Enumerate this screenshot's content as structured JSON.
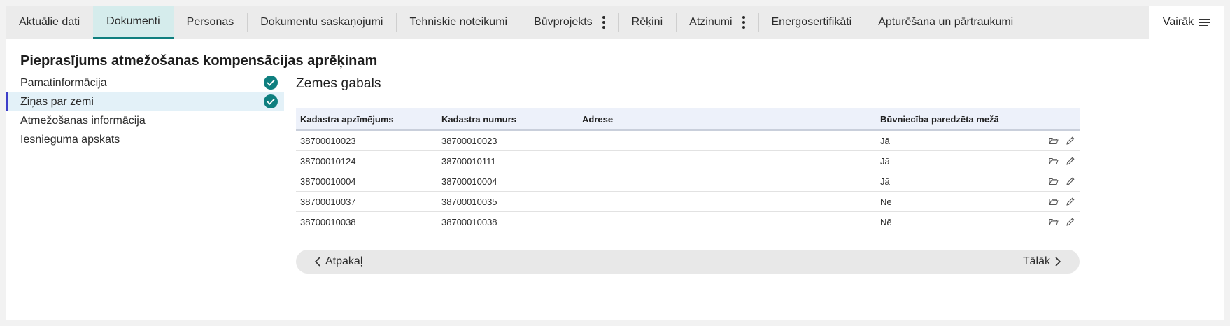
{
  "tabs": [
    {
      "label": "Aktuālie dati",
      "active": false,
      "menu": false
    },
    {
      "label": "Dokumenti",
      "active": true,
      "menu": false
    },
    {
      "label": "Personas",
      "active": false,
      "menu": false
    },
    {
      "label": "Dokumentu saskaņojumi",
      "active": false,
      "menu": false
    },
    {
      "label": "Tehniskie noteikumi",
      "active": false,
      "menu": false
    },
    {
      "label": "Būvprojekts",
      "active": false,
      "menu": true
    },
    {
      "label": "Rēķini",
      "active": false,
      "menu": false
    },
    {
      "label": "Atzinumi",
      "active": false,
      "menu": true
    },
    {
      "label": "Energosertifikāti",
      "active": false,
      "menu": false
    },
    {
      "label": "Apturēšana un pārtraukumi",
      "active": false,
      "menu": false
    }
  ],
  "more_label": "Vairāk",
  "page_title": "Pieprasījums atmežošanas kompensācijas aprēķinam",
  "nav": [
    {
      "label": "Pamatinformācija",
      "done": true,
      "active": false
    },
    {
      "label": "Ziņas par zemi",
      "done": true,
      "active": true
    },
    {
      "label": "Atmežošanas informācija",
      "done": false,
      "active": false
    },
    {
      "label": "Iesnieguma apskats",
      "done": false,
      "active": false
    }
  ],
  "section_title": "Zemes gabals",
  "table": {
    "headers": [
      "Kadastra apzīmējums",
      "Kadastra numurs",
      "Adrese",
      "Būvniecība paredzēta mežā"
    ],
    "rows": [
      [
        "38700010023",
        "38700010023",
        "",
        "Jā"
      ],
      [
        "38700010124",
        "38700010111",
        "",
        "Jā"
      ],
      [
        "38700010004",
        "38700010004",
        "",
        "Jā"
      ],
      [
        "38700010037",
        "38700010035",
        "",
        "Nē"
      ],
      [
        "38700010038",
        "38700010038",
        "",
        "Nē"
      ]
    ]
  },
  "pager": {
    "back_label": "Atpakaļ",
    "next_label": "Tālāk"
  },
  "colors": {
    "accent": "#0f7f7f",
    "nav_active_bar": "#3e3ec9",
    "tab_active_bg": "#d5ecec"
  },
  "icons": {
    "row_actions": [
      "folder-open-icon",
      "pencil-icon"
    ],
    "check": "check-circle-icon",
    "more": "menu-lines-icon"
  }
}
